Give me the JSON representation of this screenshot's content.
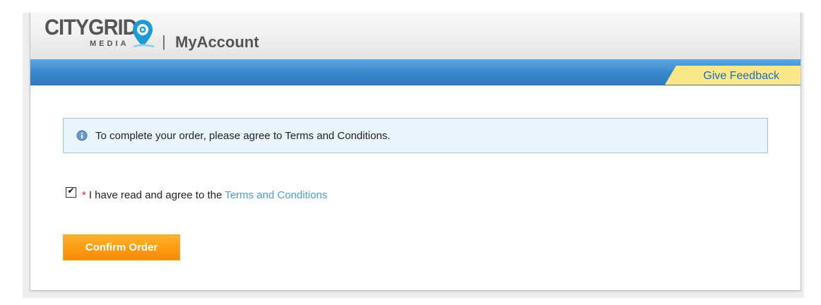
{
  "header": {
    "logo_word": "CITYGRID",
    "logo_sub": "MEDIA",
    "separator": "|",
    "title": "MyAccount"
  },
  "nav": {
    "feedback_label": "Give Feedback",
    "feedback_color": "#fbe68a",
    "bar_color": "#3a89cc"
  },
  "notice": {
    "icon": "info-icon",
    "text": "To complete your order, please agree to Terms and Conditions."
  },
  "agreement": {
    "checked": true,
    "required_mark": "*",
    "label": "I have read and agree to the ",
    "link_text": "Terms and Conditions"
  },
  "actions": {
    "confirm_label": "Confirm Order",
    "confirm_color": "#ff9c12"
  }
}
